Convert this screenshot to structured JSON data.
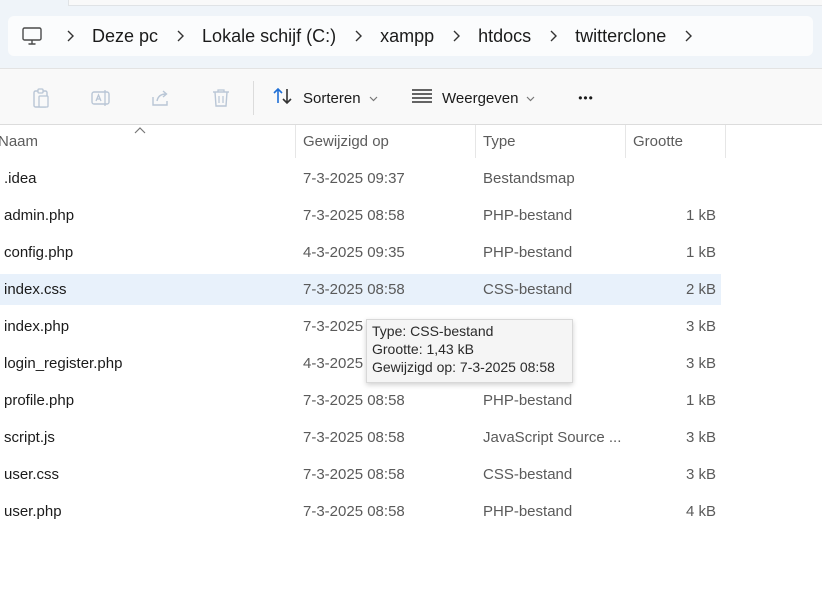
{
  "breadcrumb": {
    "items": [
      "Deze pc",
      "Lokale schijf (C:)",
      "xampp",
      "htdocs",
      "twitterclone"
    ]
  },
  "toolbar": {
    "sort_label": "Sorteren",
    "view_label": "Weergeven",
    "more_label": "•••"
  },
  "columns": {
    "name": "Naam",
    "modified": "Gewijzigd op",
    "type": "Type",
    "size": "Grootte"
  },
  "files": [
    {
      "name": ".idea",
      "modified": "7-3-2025 09:37",
      "type": "Bestandsmap",
      "size": ""
    },
    {
      "name": "admin.php",
      "modified": "7-3-2025 08:58",
      "type": "PHP-bestand",
      "size": "1 kB"
    },
    {
      "name": "config.php",
      "modified": "4-3-2025 09:35",
      "type": "PHP-bestand",
      "size": "1 kB"
    },
    {
      "name": "index.css",
      "modified": "7-3-2025 08:58",
      "type": "CSS-bestand",
      "size": "2 kB"
    },
    {
      "name": "index.php",
      "modified": "7-3-2025",
      "type": "",
      "size": "3 kB"
    },
    {
      "name": "login_register.php",
      "modified": "4-3-2025",
      "type": "",
      "size": "3 kB"
    },
    {
      "name": "profile.php",
      "modified": "7-3-2025 08:58",
      "type": "PHP-bestand",
      "size": "1 kB"
    },
    {
      "name": "script.js",
      "modified": "7-3-2025 08:58",
      "type": "JavaScript Source ...",
      "size": "3 kB"
    },
    {
      "name": "user.css",
      "modified": "7-3-2025 08:58",
      "type": "CSS-bestand",
      "size": "3 kB"
    },
    {
      "name": "user.php",
      "modified": "7-3-2025 08:58",
      "type": "PHP-bestand",
      "size": "4 kB"
    }
  ],
  "tooltip": {
    "line1": "Type: CSS-bestand",
    "line2": "Grootte: 1,43 kB",
    "line3": "Gewijzigd op: 7-3-2025 08:58"
  },
  "colors": {
    "selection": "#e8f1fb",
    "accent": "#1f6fd6"
  }
}
